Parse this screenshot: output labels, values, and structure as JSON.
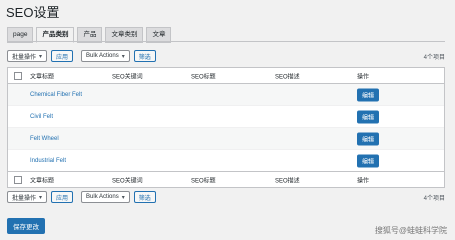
{
  "page": {
    "title": "SEO设置"
  },
  "tabs": [
    {
      "label": "page"
    },
    {
      "label": "产品类别"
    },
    {
      "label": "产品"
    },
    {
      "label": "文章类别"
    },
    {
      "label": "文章"
    }
  ],
  "toolbar": {
    "bulk_select_label": "批量操作",
    "apply_label": "应用",
    "bulk_actions_label": "Bulk Actions",
    "filter_label": "筛选",
    "item_count": "4个项目"
  },
  "table": {
    "headers": [
      "文章标题",
      "SEO关键词",
      "SEO标题",
      "SEO描述",
      "操作"
    ],
    "rows": [
      {
        "title": "Chemical Fiber Felt",
        "action": "编辑"
      },
      {
        "title": "Civil Felt",
        "action": "编辑"
      },
      {
        "title": "Felt Wheel",
        "action": "编辑"
      },
      {
        "title": "Industrial Felt",
        "action": "编辑"
      }
    ]
  },
  "save_label": "保存更改",
  "watermark": "搜狐号@蛙蛙科学院"
}
